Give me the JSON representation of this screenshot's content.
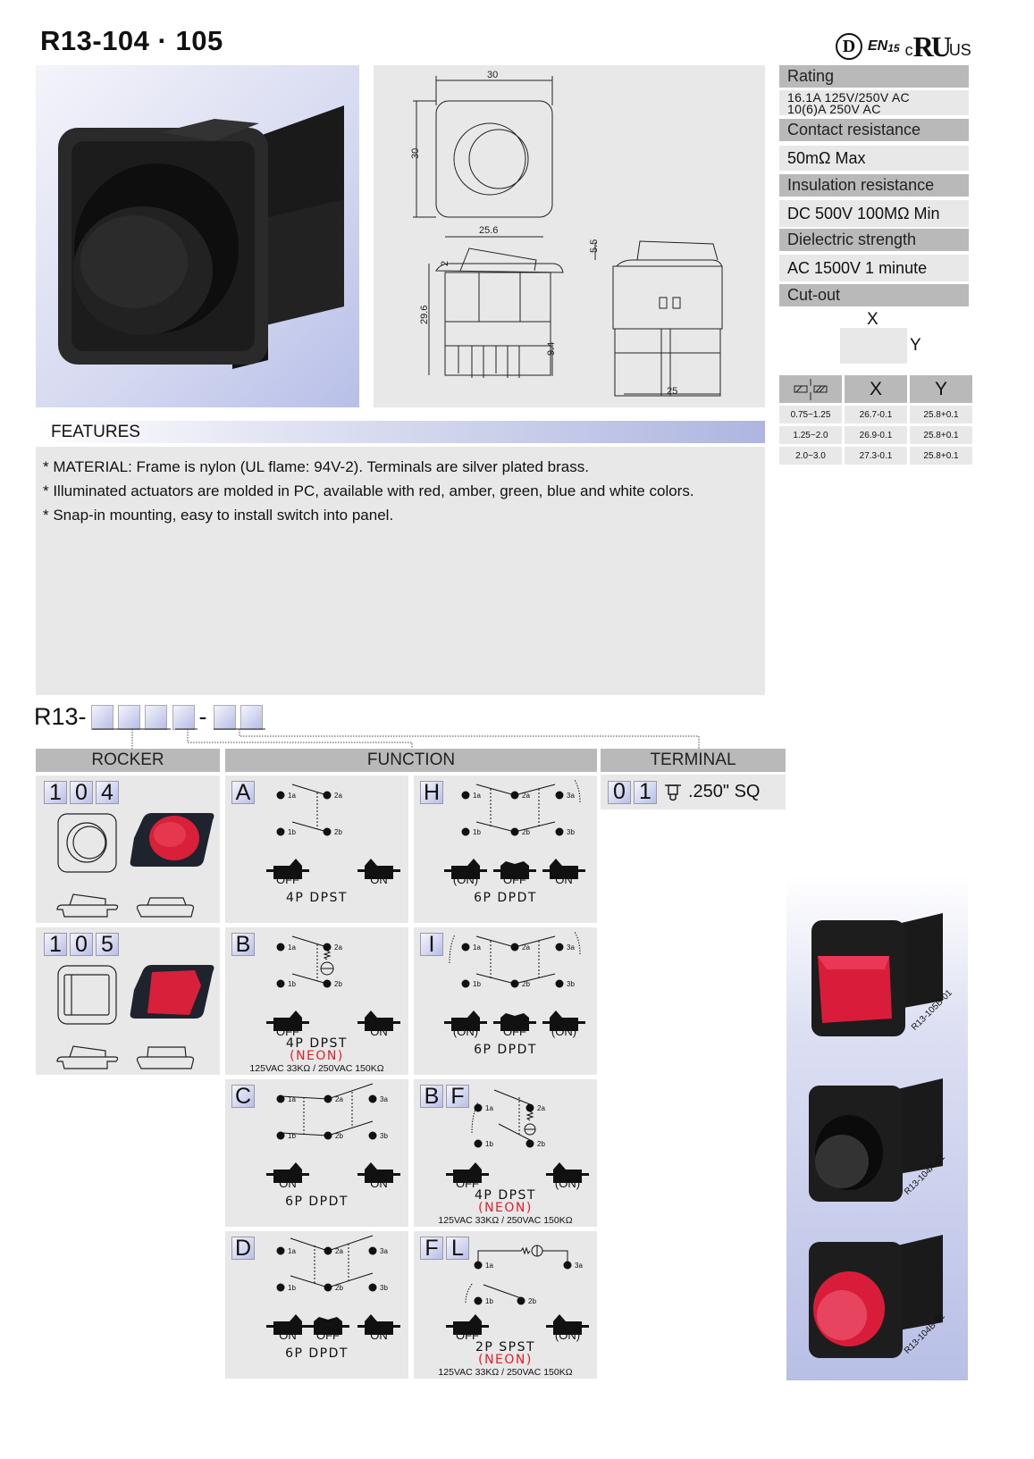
{
  "header": {
    "title": "R13-104 · 105",
    "certifications": [
      "D",
      "ENEC 15",
      "cULus"
    ],
    "cert_text": {
      "d": "D",
      "enec": "EN",
      "enec_num": "15",
      "ul_c": "c",
      "ul_mark": "RU",
      "ul_us": "US"
    }
  },
  "drawing": {
    "dimensions": {
      "top_width": "30",
      "top_height": "30",
      "side_width": "25.6",
      "bezel": "2",
      "height": "29.6",
      "pin": "9.4",
      "actuator": "5.5",
      "end_width": "25"
    }
  },
  "specs": [
    {
      "label": "Rating",
      "value_lines": [
        "16.1A 125V/250V AC",
        "10(6)A 250V AC"
      ]
    },
    {
      "label": "Contact resistance",
      "value": "50mΩ Max"
    },
    {
      "label": "Insulation resistance",
      "value": "DC 500V 100MΩ Min"
    },
    {
      "label": "Dielectric strength",
      "value": "AC 1500V 1 minute"
    },
    {
      "label": "Cut-out"
    }
  ],
  "cutout": {
    "x_label": "X",
    "y_label": "Y",
    "table": {
      "headers": [
        "panel-thickness-icon",
        "X",
        "Y"
      ],
      "rows": [
        [
          "0.75~1.25",
          "26.7-0.1",
          "25.8+0.1"
        ],
        [
          "1.25~2.0",
          "26.9-0.1",
          "25.8+0.1"
        ],
        [
          "2.0~3.0",
          "27.3-0.1",
          "25.8+0.1"
        ]
      ]
    }
  },
  "features": {
    "title": "FEATURES",
    "items": [
      "* MATERIAL: Frame is nylon (UL flame: 94V-2). Terminals are silver plated brass.",
      "* Illuminated actuators are molded in PC, available with red, amber, green, blue and white colors.",
      "* Snap-in mounting, easy to install switch into panel."
    ]
  },
  "part_number": {
    "prefix": "R13-",
    "dash": "-"
  },
  "ordering": {
    "columns": {
      "rocker": "ROCKER",
      "function": "FUNCTION",
      "terminal": "TERMINAL"
    },
    "rockers": [
      {
        "code": [
          "1",
          "0",
          "4"
        ],
        "shape": "round"
      },
      {
        "code": [
          "1",
          "0",
          "5"
        ],
        "shape": "square"
      }
    ],
    "functions": [
      {
        "code": [
          "A"
        ],
        "positions": [
          "OFF",
          "ON"
        ],
        "name": "4P DPST"
      },
      {
        "code": [
          "H"
        ],
        "positions": [
          "(ON)",
          "OFF",
          "ON"
        ],
        "name": "6P DPDT"
      },
      {
        "code": [
          "B"
        ],
        "positions": [
          "OFF",
          "ON"
        ],
        "name": "4P DPST",
        "neon": "(NEON)",
        "voltage": "125VAC 33KΩ / 250VAC 150KΩ"
      },
      {
        "code": [
          "I"
        ],
        "positions": [
          "(ON)",
          "OFF",
          "(ON)"
        ],
        "name": "6P DPDT"
      },
      {
        "code": [
          "C"
        ],
        "positions": [
          "ON",
          "ON"
        ],
        "name": "6P DPDT"
      },
      {
        "code": [
          "B",
          "F"
        ],
        "positions": [
          "OFF",
          "(ON)"
        ],
        "name": "4P DPST",
        "neon": "(NEON)",
        "voltage": "125VAC 33KΩ / 250VAC 150KΩ"
      },
      {
        "code": [
          "D"
        ],
        "positions": [
          "ON",
          "OFF",
          "ON"
        ],
        "name": "6P DPDT"
      },
      {
        "code": [
          "F",
          "L"
        ],
        "positions": [
          "OFF",
          "(ON)"
        ],
        "name": "2P SPST",
        "neon": "(NEON)",
        "voltage": "125VAC 33KΩ / 250VAC 150KΩ"
      }
    ],
    "terminal": {
      "code": [
        "0",
        "1"
      ],
      "label": ".250\" SQ"
    }
  },
  "product_photos": [
    "R13-105B-01",
    "R13-104A-01",
    "R13-104B-01"
  ],
  "colors": {
    "header_gray": "#b9b9b9",
    "panel_gray": "#e8e8e8",
    "accent_blue": "#b6bde6",
    "neon_red": "#e0202a"
  }
}
